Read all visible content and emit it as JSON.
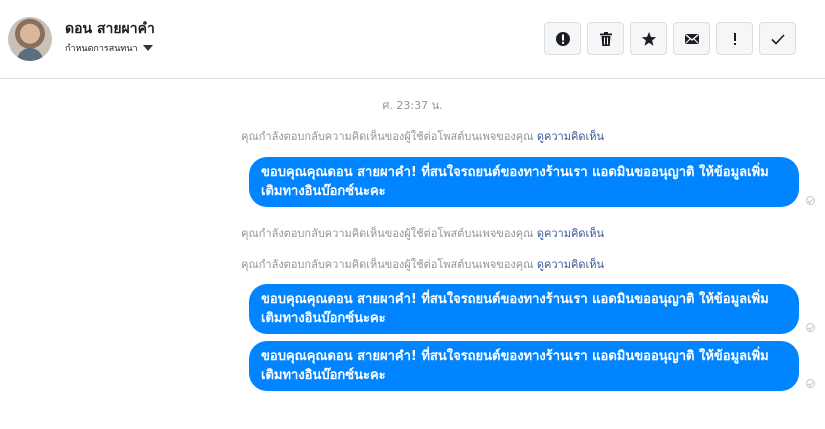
{
  "header": {
    "name": "ดอน สายผาคำ",
    "subtitle": "กำหนดการสนทนา",
    "toolbar": [
      {
        "icon": "alert-circle-icon"
      },
      {
        "icon": "trash-icon"
      },
      {
        "icon": "star-icon"
      },
      {
        "icon": "envelope-icon"
      },
      {
        "icon": "exclamation-icon"
      },
      {
        "icon": "check-icon"
      }
    ]
  },
  "thread": {
    "timestamp": "ศ. 23:37 น.",
    "notices": [
      {
        "text": "คุณกำลังตอบกลับความคิดเห็นของผู้ใช้ต่อโพสต์บนเพจของคุณ",
        "link": "ดูความคิดเห็น"
      },
      {
        "text": "คุณกำลังตอบกลับความคิดเห็นของผู้ใช้ต่อโพสต์บนเพจของคุณ",
        "link": "ดูความคิดเห็น"
      },
      {
        "text": "คุณกำลังตอบกลับความคิดเห็นของผู้ใช้ต่อโพสต์บนเพจของคุณ",
        "link": "ดูความคิดเห็น"
      }
    ],
    "messages": [
      {
        "text": "ขอบคุณคุณดอน สายผาคำ! ที่สนใจรถยนต์ของทางร้านเรา แอดมินขออนุญาติ ให้ข้อมูลเพิ่มเติมทางอินบ๊อกซ์นะคะ"
      },
      {
        "text": "ขอบคุณคุณดอน สายผาคำ! ที่สนใจรถยนต์ของทางร้านเรา แอดมินขออนุญาติ ให้ข้อมูลเพิ่มเติมทางอินบ๊อกซ์นะคะ"
      },
      {
        "text": "ขอบคุณคุณดอน สายผาคำ! ที่สนใจรถยนต์ของทางร้านเรา แอดมินขออนุญาติ ให้ข้อมูลเพิ่มเติมทางอินบ๊อกซ์นะคะ"
      }
    ]
  },
  "colors": {
    "bubble": "#0084ff",
    "link": "#385898",
    "muted": "#90949c"
  }
}
